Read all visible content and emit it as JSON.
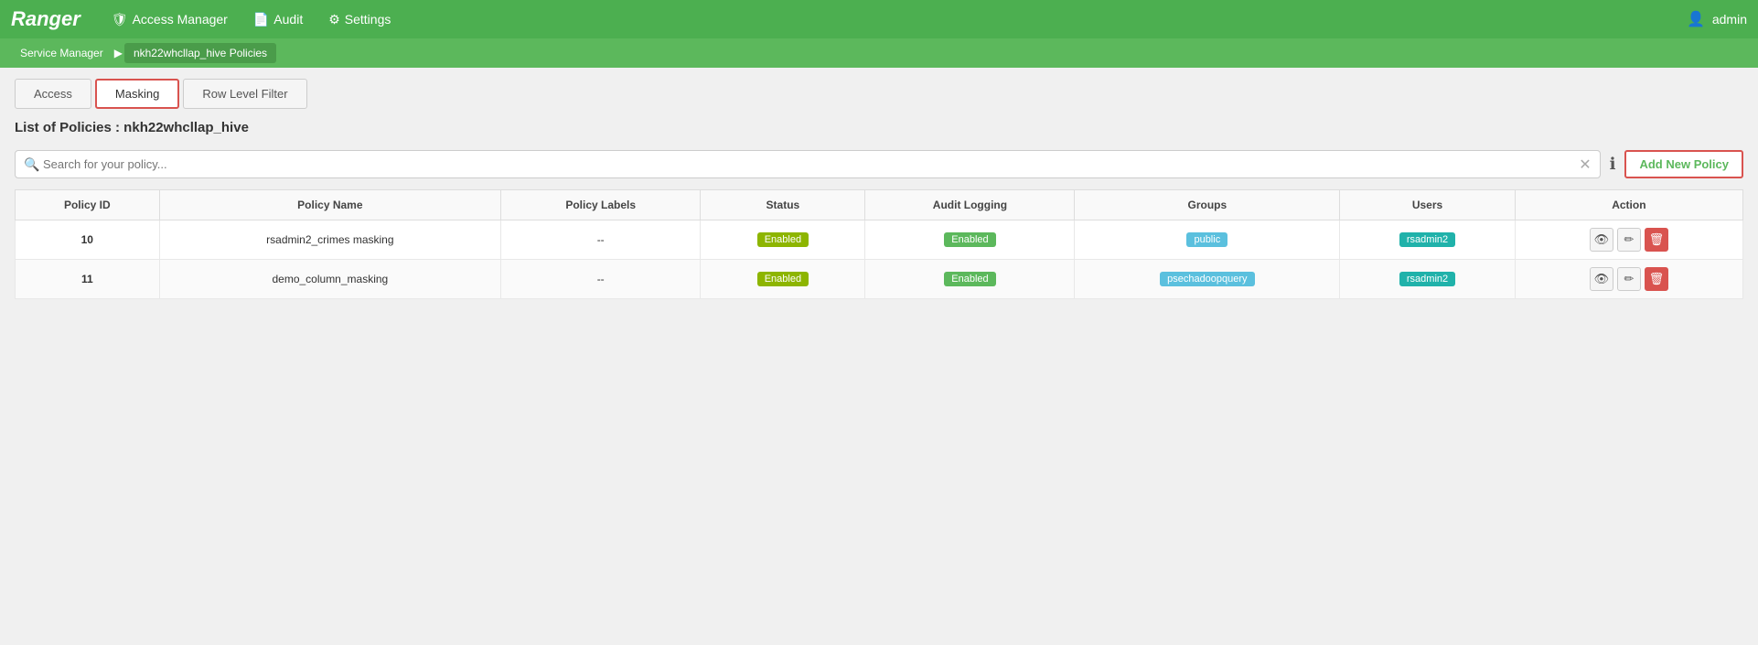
{
  "brand": "Ranger",
  "nav": {
    "access_manager_label": "Access Manager",
    "audit_label": "Audit",
    "settings_label": "Settings",
    "admin_label": "admin"
  },
  "breadcrumb": {
    "service_manager_label": "Service Manager",
    "current_label": "nkh22whcllap_hive Policies"
  },
  "tabs": {
    "access_label": "Access",
    "masking_label": "Masking",
    "row_level_filter_label": "Row Level Filter"
  },
  "page_title": "List of Policies : nkh22whcllap_hive",
  "search": {
    "placeholder": "Search for your policy..."
  },
  "add_button_label": "Add New Policy",
  "table": {
    "headers": {
      "policy_id": "Policy ID",
      "policy_name": "Policy Name",
      "policy_labels": "Policy Labels",
      "status": "Status",
      "audit_logging": "Audit Logging",
      "groups": "Groups",
      "users": "Users",
      "action": "Action"
    },
    "rows": [
      {
        "id": "10",
        "name": "rsadmin2_crimes masking",
        "labels": "--",
        "status": "Enabled",
        "audit_logging": "Enabled",
        "groups": "public",
        "users": "rsadmin2"
      },
      {
        "id": "11",
        "name": "demo_column_masking",
        "labels": "--",
        "status": "Enabled",
        "audit_logging": "Enabled",
        "groups": "psechadoopquery",
        "users": "rsadmin2"
      }
    ]
  }
}
